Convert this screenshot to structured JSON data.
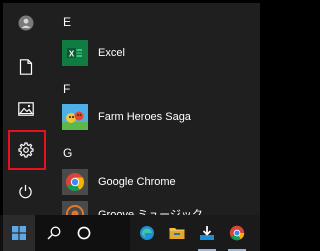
{
  "start_menu": {
    "rail": {
      "items": [
        {
          "icon": "user-icon"
        },
        {
          "icon": "document-icon"
        },
        {
          "icon": "pictures-icon"
        },
        {
          "icon": "gear-icon"
        },
        {
          "icon": "power-icon"
        }
      ],
      "highlight_color": "#e8101e"
    },
    "sections": [
      {
        "letter": "E",
        "apps": [
          {
            "name": "Excel",
            "icon": "excel-icon",
            "color": "#107c41"
          }
        ]
      },
      {
        "letter": "F",
        "apps": [
          {
            "name": "Farm Heroes Saga",
            "icon": "farm-heroes-saga-icon",
            "color": "#3a9ad9"
          }
        ]
      },
      {
        "letter": "G",
        "apps": [
          {
            "name": "Google Chrome",
            "icon": "chrome-icon",
            "color": "#4a4a4a"
          },
          {
            "name": "Groove ミュージック",
            "icon": "groove-music-icon",
            "color": "#4a4a4a"
          }
        ]
      }
    ]
  },
  "taskbar": {
    "items": [
      {
        "icon": "windows-start-icon"
      },
      {
        "icon": "search-icon"
      },
      {
        "icon": "task-view-icon"
      },
      {
        "icon": "edge-icon"
      },
      {
        "icon": "file-explorer-icon"
      },
      {
        "icon": "store-download-icon"
      },
      {
        "icon": "chrome-icon"
      }
    ],
    "accent": "#0078d7"
  }
}
